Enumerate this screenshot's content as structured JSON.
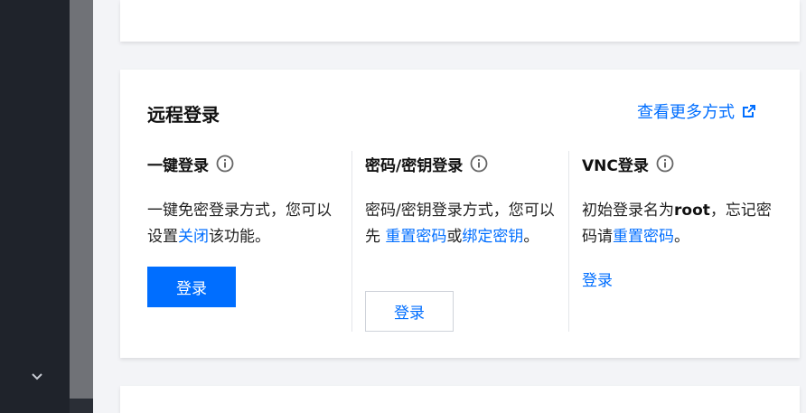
{
  "sidebar": {
    "toggle_icon": "chevron-down-icon"
  },
  "remote_login": {
    "title": "远程登录",
    "more_link": "查看更多方式",
    "more_link_icon": "external-link-icon",
    "methods": [
      {
        "title": "一键登录",
        "info_icon": "info-icon",
        "desc_prefix": "一键免密登录方式，您可以设置",
        "desc_link": "关闭",
        "desc_suffix": "该功能。",
        "action_label": "登录"
      },
      {
        "title": "密码/密钥登录",
        "info_icon": "info-icon",
        "desc_prefix": "密码/密钥登录方式，您可以先 ",
        "desc_link1": "重置密码",
        "desc_mid": "或",
        "desc_link2": "绑定密钥",
        "desc_suffix": "。",
        "action_label": "登录"
      },
      {
        "title": "VNC登录",
        "info_icon": "info-icon",
        "desc_prefix": "初始登录名为",
        "desc_bold": "root",
        "desc_mid": "，忘记密码请",
        "desc_link": "重置密码",
        "desc_suffix": "。",
        "action_label": "登录"
      }
    ]
  },
  "colors": {
    "accent": "#006eff",
    "sidebar_bg": "#1f232b",
    "content_bg": "#f3f4f7"
  }
}
